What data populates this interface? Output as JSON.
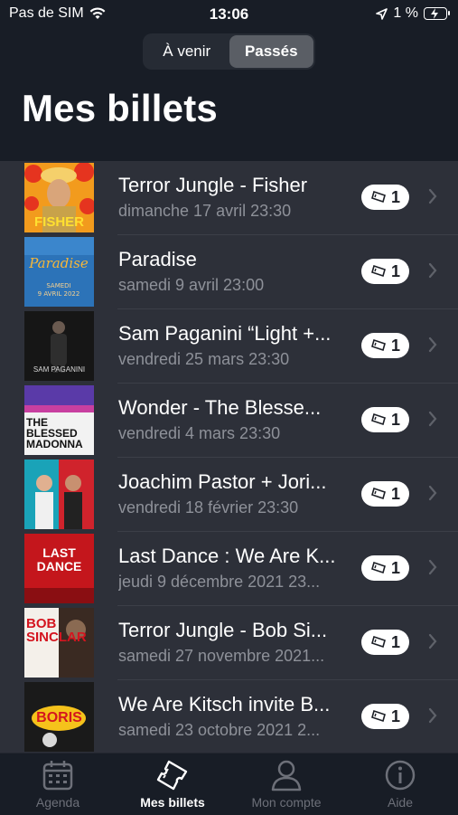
{
  "status": {
    "carrier": "Pas de SIM",
    "time": "13:06",
    "battery": "1 %"
  },
  "segments": {
    "upcoming": "À venir",
    "past": "Passés"
  },
  "page_title": "Mes billets",
  "tickets": [
    {
      "title": "Terror Jungle - Fisher",
      "date": "dimanche 17 avril 23:30",
      "count": "1",
      "thumb_text": "FISHER"
    },
    {
      "title": "Paradise",
      "date": "samedi 9 avril 23:00",
      "count": "1",
      "thumb_text": "Paradise"
    },
    {
      "title": "Sam Paganini “Light +...",
      "date": "vendredi 25 mars 23:30",
      "count": "1",
      "thumb_text": "SAM PAGANINI"
    },
    {
      "title": "Wonder - The Blesse...",
      "date": "vendredi 4 mars 23:30",
      "count": "1",
      "thumb_text": "THE BLESSED MADONNA"
    },
    {
      "title": "Joachim Pastor + Jori...",
      "date": "vendredi 18 février 23:30",
      "count": "1",
      "thumb_text": ""
    },
    {
      "title": "Last Dance : We Are K...",
      "date": "jeudi 9 décembre 2021 23...",
      "count": "1",
      "thumb_text": "LAST DANCE"
    },
    {
      "title": "Terror Jungle - Bob Si...",
      "date": "samedi 27 novembre 2021...",
      "count": "1",
      "thumb_text": "BOB SINCLAR"
    },
    {
      "title": "We Are Kitsch invite B...",
      "date": "samedi 23 octobre 2021 2...",
      "count": "1",
      "thumb_text": "BORIS"
    }
  ],
  "tab_bar": {
    "agenda": "Agenda",
    "tickets": "Mes billets",
    "account": "Mon compte",
    "help": "Aide"
  }
}
